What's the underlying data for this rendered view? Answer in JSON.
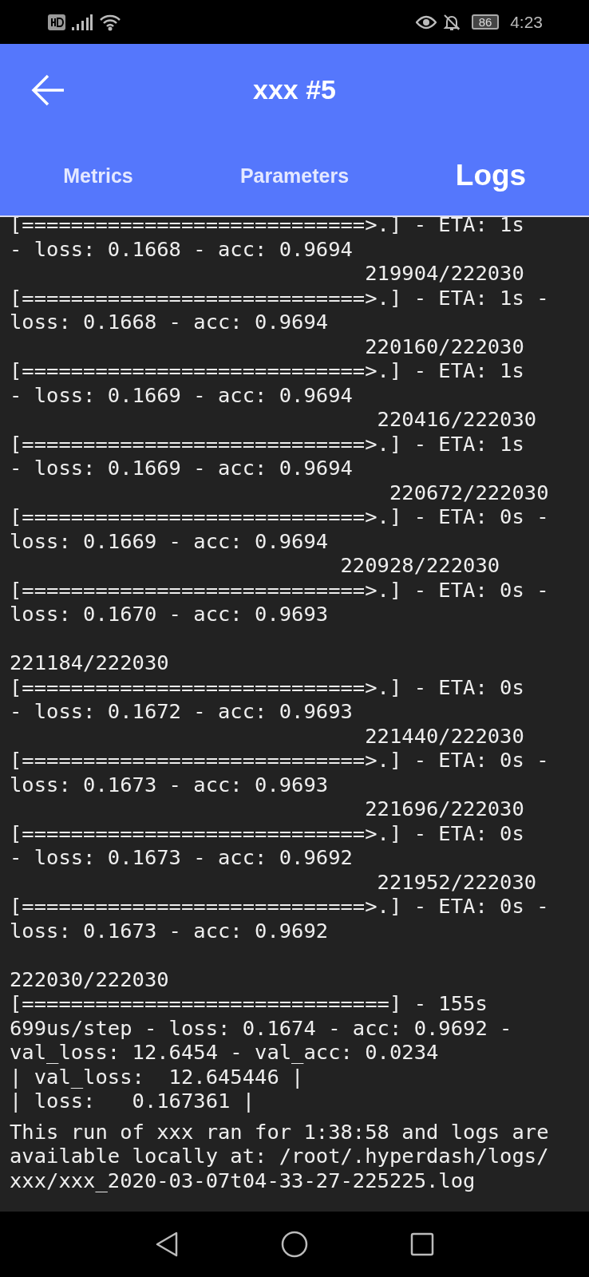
{
  "status_bar": {
    "battery": "86",
    "time": "4:23"
  },
  "app_bar": {
    "title": "xxx #5"
  },
  "tabs": [
    {
      "label": "Metrics",
      "selected": false
    },
    {
      "label": "Parameters",
      "selected": false
    },
    {
      "label": "Logs",
      "selected": true
    }
  ],
  "log_lines": [
    {
      "kind": "text",
      "text": "[============================>.] - ETA: 1s"
    },
    {
      "kind": "text",
      "text": "- loss: 0.1668 - acc: 0.9694"
    },
    {
      "kind": "text",
      "text": "                             219904/222030"
    },
    {
      "kind": "text",
      "text": "[============================>.] - ETA: 1s -"
    },
    {
      "kind": "text",
      "text": "loss: 0.1668 - acc: 0.9694"
    },
    {
      "kind": "text",
      "text": "                             220160/222030"
    },
    {
      "kind": "text",
      "text": "[============================>.] - ETA: 1s"
    },
    {
      "kind": "text",
      "text": "- loss: 0.1669 - acc: 0.9694"
    },
    {
      "kind": "text",
      "text": "                              220416/222030"
    },
    {
      "kind": "text",
      "text": "[============================>.] - ETA: 1s"
    },
    {
      "kind": "text",
      "text": "- loss: 0.1669 - acc: 0.9694"
    },
    {
      "kind": "text",
      "text": "                               220672/222030"
    },
    {
      "kind": "text",
      "text": "[============================>.] - ETA: 0s -"
    },
    {
      "kind": "text",
      "text": "loss: 0.1669 - acc: 0.9694"
    },
    {
      "kind": "text",
      "text": "                           220928/222030"
    },
    {
      "kind": "text",
      "text": "[============================>.] - ETA: 0s -"
    },
    {
      "kind": "text",
      "text": "loss: 0.1670 - acc: 0.9693"
    },
    {
      "kind": "blank"
    },
    {
      "kind": "text",
      "text": "221184/222030"
    },
    {
      "kind": "text",
      "text": "[============================>.] - ETA: 0s"
    },
    {
      "kind": "text",
      "text": "- loss: 0.1672 - acc: 0.9693"
    },
    {
      "kind": "text",
      "text": "                             221440/222030"
    },
    {
      "kind": "text",
      "text": "[============================>.] - ETA: 0s -"
    },
    {
      "kind": "text",
      "text": "loss: 0.1673 - acc: 0.9693"
    },
    {
      "kind": "text",
      "text": "                             221696/222030"
    },
    {
      "kind": "text",
      "text": "[============================>.] - ETA: 0s"
    },
    {
      "kind": "text",
      "text": "- loss: 0.1673 - acc: 0.9692"
    },
    {
      "kind": "text",
      "text": "                              221952/222030"
    },
    {
      "kind": "text",
      "text": "[============================>.] - ETA: 0s -"
    },
    {
      "kind": "text",
      "text": "loss: 0.1673 - acc: 0.9692"
    },
    {
      "kind": "blank"
    },
    {
      "kind": "text",
      "text": "222030/222030"
    },
    {
      "kind": "text",
      "text": "[==============================] - 155s"
    },
    {
      "kind": "text",
      "text": "699us/step - loss: 0.1674 - acc: 0.9692 -"
    },
    {
      "kind": "text",
      "text": "val_loss: 12.6454 - val_acc: 0.0234"
    },
    {
      "kind": "text",
      "text": "| val_loss:  12.645446 |"
    },
    {
      "kind": "text",
      "text": "| loss:   0.167361 |"
    }
  ],
  "summary": "This run of xxx ran for 1:38:58 and logs are available locally at: /root/.hyperdash/logs/xxx/xxx_2020-03-07t04-33-27-225225.log"
}
